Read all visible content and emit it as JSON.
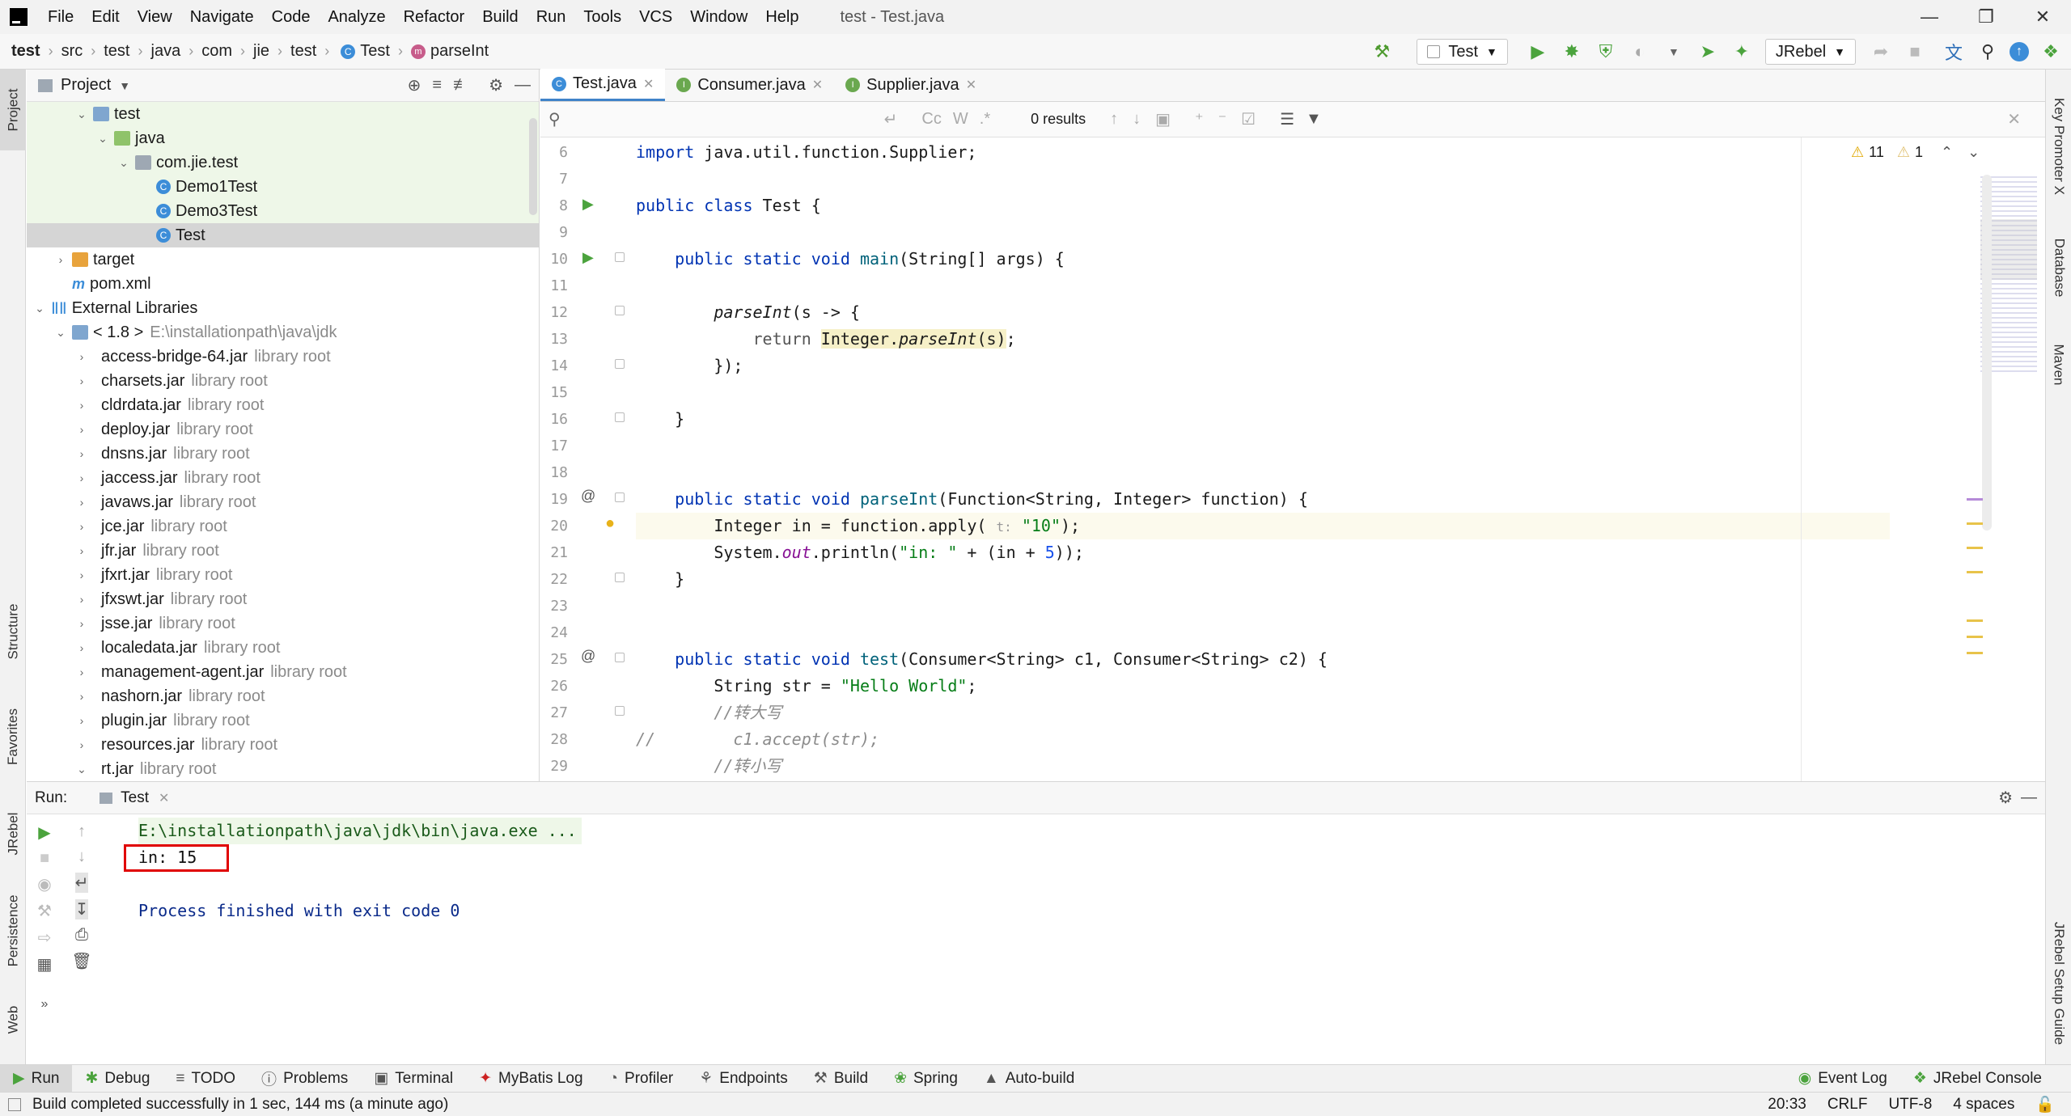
{
  "window": {
    "title": "test - Test.java"
  },
  "menu": [
    "File",
    "Edit",
    "View",
    "Navigate",
    "Code",
    "Analyze",
    "Refactor",
    "Build",
    "Run",
    "Tools",
    "VCS",
    "Window",
    "Help"
  ],
  "breadcrumb": [
    "test",
    "src",
    "test",
    "java",
    "com",
    "jie",
    "test",
    "Test",
    "parseInt"
  ],
  "toolbar": {
    "run_config": "Test",
    "jrebel": "JRebel"
  },
  "project": {
    "header": "Project",
    "items": [
      {
        "label": "test",
        "depth": 2,
        "type": "folder-blue",
        "open": true,
        "green": true
      },
      {
        "label": "java",
        "depth": 3,
        "type": "folder-green",
        "open": true,
        "green": true
      },
      {
        "label": "com.jie.test",
        "depth": 4,
        "type": "folder",
        "open": true,
        "green": true
      },
      {
        "label": "Demo1Test",
        "depth": 5,
        "type": "class",
        "green": true
      },
      {
        "label": "Demo3Test",
        "depth": 5,
        "type": "class",
        "green": true
      },
      {
        "label": "Test",
        "depth": 5,
        "type": "class",
        "selected": true
      },
      {
        "label": "target",
        "depth": 1,
        "type": "folder-orange",
        "closed": true
      },
      {
        "label": "pom.xml",
        "depth": 1,
        "type": "maven"
      },
      {
        "label": "External Libraries",
        "depth": 0,
        "type": "libs",
        "open": true
      },
      {
        "label": "< 1.8 >",
        "extra": "E:\\installationpath\\java\\jdk",
        "depth": 1,
        "type": "folder-blue",
        "open": true
      },
      {
        "label": "access-bridge-64.jar",
        "extra": "library root",
        "depth": 2,
        "type": "jar",
        "closed": true
      },
      {
        "label": "charsets.jar",
        "extra": "library root",
        "depth": 2,
        "type": "jar",
        "closed": true
      },
      {
        "label": "cldrdata.jar",
        "extra": "library root",
        "depth": 2,
        "type": "jar",
        "closed": true
      },
      {
        "label": "deploy.jar",
        "extra": "library root",
        "depth": 2,
        "type": "jar",
        "closed": true
      },
      {
        "label": "dnsns.jar",
        "extra": "library root",
        "depth": 2,
        "type": "jar",
        "closed": true
      },
      {
        "label": "jaccess.jar",
        "extra": "library root",
        "depth": 2,
        "type": "jar",
        "closed": true
      },
      {
        "label": "javaws.jar",
        "extra": "library root",
        "depth": 2,
        "type": "jar",
        "closed": true
      },
      {
        "label": "jce.jar",
        "extra": "library root",
        "depth": 2,
        "type": "jar",
        "closed": true
      },
      {
        "label": "jfr.jar",
        "extra": "library root",
        "depth": 2,
        "type": "jar",
        "closed": true
      },
      {
        "label": "jfxrt.jar",
        "extra": "library root",
        "depth": 2,
        "type": "jar",
        "closed": true
      },
      {
        "label": "jfxswt.jar",
        "extra": "library root",
        "depth": 2,
        "type": "jar",
        "closed": true
      },
      {
        "label": "jsse.jar",
        "extra": "library root",
        "depth": 2,
        "type": "jar",
        "closed": true
      },
      {
        "label": "localedata.jar",
        "extra": "library root",
        "depth": 2,
        "type": "jar",
        "closed": true
      },
      {
        "label": "management-agent.jar",
        "extra": "library root",
        "depth": 2,
        "type": "jar",
        "closed": true
      },
      {
        "label": "nashorn.jar",
        "extra": "library root",
        "depth": 2,
        "type": "jar",
        "closed": true
      },
      {
        "label": "plugin.jar",
        "extra": "library root",
        "depth": 2,
        "type": "jar",
        "closed": true
      },
      {
        "label": "resources.jar",
        "extra": "library root",
        "depth": 2,
        "type": "jar",
        "closed": true
      },
      {
        "label": "rt.jar",
        "extra": "library root",
        "depth": 2,
        "type": "jar",
        "open": true
      }
    ]
  },
  "editor": {
    "tabs": [
      {
        "label": "Test.java",
        "active": true,
        "color": "#3c8dd8",
        "letter": "C"
      },
      {
        "label": "Consumer.java",
        "active": false,
        "color": "#6aa84f",
        "letter": "I"
      },
      {
        "label": "Supplier.java",
        "active": false,
        "color": "#6aa84f",
        "letter": "I"
      }
    ],
    "search": {
      "results": "0 results",
      "case": "Cc",
      "word": "W",
      "regex": ".*"
    },
    "inspections": {
      "warnings": "11",
      "weak": "1"
    },
    "lines": [
      {
        "n": "6",
        "html": "<span class=\"kw\">import</span> java.util.function.Supplier;"
      },
      {
        "n": "7",
        "html": ""
      },
      {
        "n": "8",
        "html": "<span class=\"kw\">public class</span> Test {",
        "run": true
      },
      {
        "n": "9",
        "html": ""
      },
      {
        "n": "10",
        "html": "    <span class=\"kw\">public static void</span> <span class=\"fn\">main</span>(String[] args) {",
        "run": true,
        "fold": true
      },
      {
        "n": "11",
        "html": ""
      },
      {
        "n": "12",
        "html": "        <span class=\"it\">parseInt</span>(s -&gt; {",
        "fold": true
      },
      {
        "n": "13",
        "html": "            <span class=\"kw\" style=\"color:#555\">return</span> <span class=\"hl\">Integer.<span class=\"it\">parseInt</span>(s)</span>;"
      },
      {
        "n": "14",
        "html": "        });",
        "fold": true
      },
      {
        "n": "15",
        "html": ""
      },
      {
        "n": "16",
        "html": "    }",
        "fold": true
      },
      {
        "n": "17",
        "html": ""
      },
      {
        "n": "18",
        "html": ""
      },
      {
        "n": "19",
        "html": "    <span class=\"kw\">public static void</span> <span class=\"fn\">parseInt</span>(Function&lt;String, Integer&gt; function) {",
        "at": true,
        "fold": true
      },
      {
        "n": "20",
        "html": "        Integer in = function.apply( <span style=\"color:#999;font-size:16px\">t:</span> <span class=\"str\">\"10\"</span>);",
        "bulb": true,
        "current": true
      },
      {
        "n": "21",
        "html": "        System.<span class=\"it\" style=\"color:#871094\">out</span>.println(<span class=\"str\">\"in: \"</span> + (in + <span class=\"num\">5</span>));"
      },
      {
        "n": "22",
        "html": "    }",
        "fold": true
      },
      {
        "n": "23",
        "html": ""
      },
      {
        "n": "24",
        "html": ""
      },
      {
        "n": "25",
        "html": "    <span class=\"kw\">public static void</span> <span class=\"fn\">test</span>(Consumer&lt;String&gt; c1, Consumer&lt;String&gt; c2) {",
        "at": true,
        "fold": true
      },
      {
        "n": "26",
        "html": "        String str = <span class=\"str\">\"Hello World\"</span>;"
      },
      {
        "n": "27",
        "html": "        <span class=\"cm\">//转大写</span>",
        "fold": true
      },
      {
        "n": "28",
        "html": "<span class=\"cm\">//        c1.accept(str);</span>"
      },
      {
        "n": "29",
        "html": "        <span class=\"cm\">//转小写</span>"
      }
    ]
  },
  "run": {
    "label": "Run:",
    "tab": "Test",
    "output": [
      {
        "text": "E:\\installationpath\\java\\jdk\\bin\\java.exe ...",
        "color": "#1a5a1a",
        "bg": "#eef7e8"
      },
      {
        "text": "in: 15",
        "color": "#111",
        "boxed": true
      },
      {
        "text": "",
        "color": "#111"
      },
      {
        "text": "Process finished with exit code 0",
        "color": "#0a2a8a"
      }
    ]
  },
  "bottom_tabs": [
    "Run",
    "Debug",
    "TODO",
    "Problems",
    "Terminal",
    "MyBatis Log",
    "Profiler",
    "Endpoints",
    "Build",
    "Spring",
    "Auto-build"
  ],
  "bottom_right": [
    "Event Log",
    "JRebel Console"
  ],
  "left_tabs": [
    "Project",
    "Structure",
    "Favorites",
    "JRebel",
    "Persistence",
    "Web"
  ],
  "right_tabs": [
    "Key Promoter X",
    "Database",
    "Maven",
    "JRebel Setup Guide"
  ],
  "status": {
    "message": "Build completed successfully in 1 sec, 144 ms (a minute ago)",
    "position": "20:33",
    "line_sep": "CRLF",
    "encoding": "UTF-8",
    "indent": "4 spaces"
  }
}
